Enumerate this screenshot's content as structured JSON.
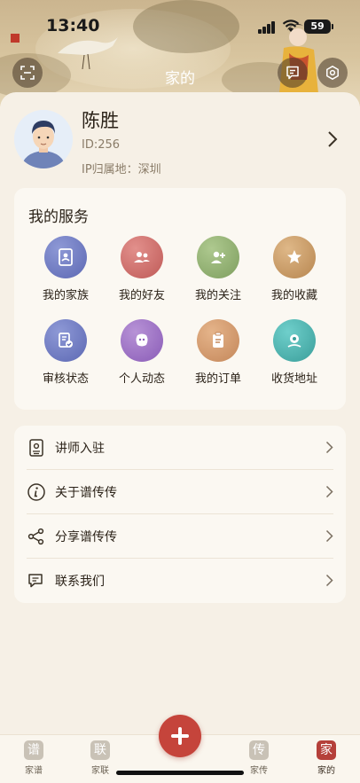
{
  "status_bar": {
    "time": "13:40",
    "battery": "59"
  },
  "header": {
    "title": "家的"
  },
  "profile": {
    "name": "陈胜",
    "id": "ID:256",
    "ip": "IP归属地：深圳"
  },
  "services": {
    "title": "我的服务",
    "items": [
      {
        "label": "我的家族",
        "icon": "address-book-icon",
        "color": "#6e7bc4"
      },
      {
        "label": "我的好友",
        "icon": "friends-icon",
        "color": "#cf6d6a"
      },
      {
        "label": "我的关注",
        "icon": "add-user-icon",
        "color": "#8fae6f"
      },
      {
        "label": "我的收藏",
        "icon": "star-icon",
        "color": "#c99b66"
      },
      {
        "label": "审核状态",
        "icon": "review-icon",
        "color": "#6e7bc4"
      },
      {
        "label": "个人动态",
        "icon": "dynamic-icon",
        "color": "#9c6fc4"
      },
      {
        "label": "我的订单",
        "icon": "clipboard-icon",
        "color": "#d49a6a"
      },
      {
        "label": "收货地址",
        "icon": "location-icon",
        "color": "#4db3b0"
      }
    ]
  },
  "menu": [
    {
      "label": "讲师入驻",
      "icon": "badge-icon"
    },
    {
      "label": "关于谱传传",
      "icon": "info-icon"
    },
    {
      "label": "分享谱传传",
      "icon": "share-icon"
    },
    {
      "label": "联系我们",
      "icon": "chat-icon"
    }
  ],
  "tabbar": {
    "tabs": [
      {
        "label": "家谱",
        "glyph": "谱"
      },
      {
        "label": "家联",
        "glyph": "联"
      },
      {
        "label": "家传",
        "glyph": "传"
      },
      {
        "label": "家的",
        "glyph": "家"
      }
    ],
    "active": "家的"
  }
}
